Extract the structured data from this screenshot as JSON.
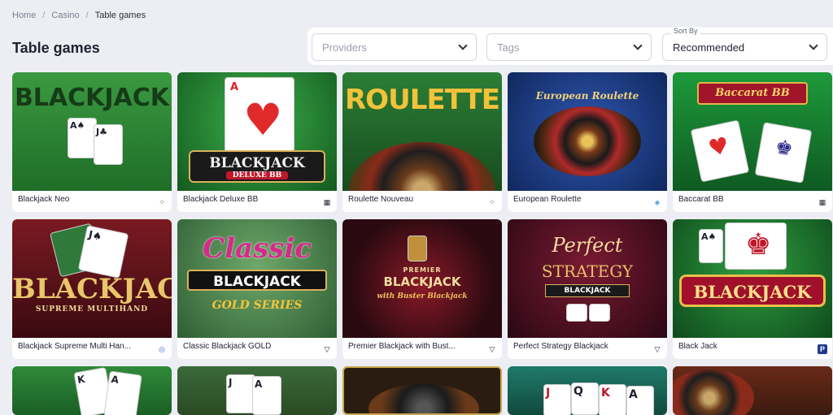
{
  "breadcrumb": {
    "home": "Home",
    "sep": "/",
    "casino": "Casino",
    "current": "Table games"
  },
  "page_title": "Table games",
  "filters": {
    "providers_placeholder": "Providers",
    "tags_placeholder": "Tags",
    "sort_label": "Sort By",
    "sort_value": "Recommended"
  },
  "games": [
    {
      "title": "Blackjack Neo",
      "thumb_text": "BLACKJACK",
      "provider_icon": "dice-icon",
      "bg": "#2f8a3a"
    },
    {
      "title": "Blackjack Deluxe BB",
      "thumb_text": "BLACKJACK",
      "thumb_sub": "DELUXE BB",
      "provider_icon": "grid-icon",
      "bg": "#1d6b2a"
    },
    {
      "title": "Roulette Nouveau",
      "thumb_text": "ROULETTE",
      "provider_icon": "dice-icon",
      "bg": "#1f6a2c"
    },
    {
      "title": "European Roulette",
      "thumb_text": "European Roulette",
      "provider_icon": "swirl-icon",
      "bg": "#17357a"
    },
    {
      "title": "Baccarat BB",
      "thumb_text": "Baccarat BB",
      "provider_icon": "grid-icon",
      "bg": "#14752e"
    },
    {
      "title": "Blackjack Supreme Multi Han...",
      "thumb_text": "BLACKJACK",
      "thumb_sub": "SUPREME MULTIHAND",
      "provider_icon": "ring-icon",
      "bg": "#5a1018"
    },
    {
      "title": "Classic Blackjack GOLD",
      "thumb_text": "Classic",
      "thumb_sub": "BLACKJACK",
      "thumb_sub2": "GOLD SERIES",
      "provider_icon": "triangle-icon",
      "bg": "#3f7d43"
    },
    {
      "title": "Premier Blackjack with Bust...",
      "thumb_text": "PREMIER",
      "thumb_sub": "BLACKJACK",
      "thumb_sub2": "with Buster Blackjack",
      "provider_icon": "triangle-icon",
      "bg": "#3a0e16"
    },
    {
      "title": "Perfect Strategy Blackjack",
      "thumb_text": "Perfect",
      "thumb_sub": "STRATEGY",
      "thumb_sub2": "BLACKJACK",
      "provider_icon": "triangle-icon",
      "bg": "#4d1020"
    },
    {
      "title": "Black Jack",
      "thumb_text": "BLACKJACK",
      "provider_icon": "p-icon",
      "bg": "#1f6d2a"
    }
  ],
  "partial_row": [
    {
      "bg": "#1f6d2a"
    },
    {
      "bg": "#2b5a2c"
    },
    {
      "bg": "#3a2a14"
    },
    {
      "bg": "#1c5f55"
    },
    {
      "bg": "#4a2316"
    }
  ]
}
